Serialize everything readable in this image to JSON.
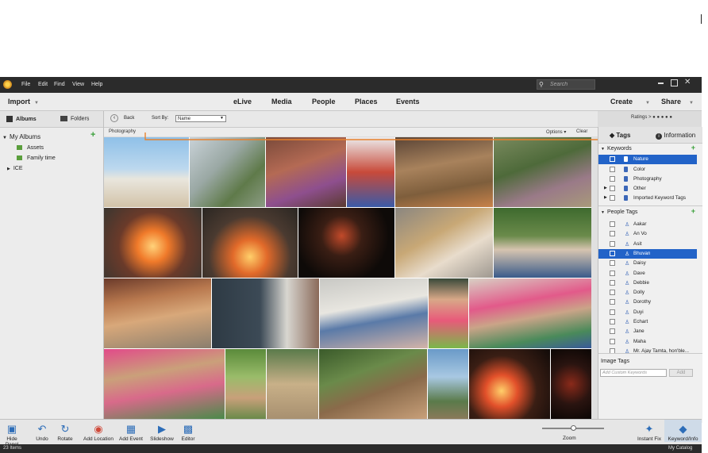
{
  "menubar": {
    "items": [
      "File",
      "Edit",
      "Find",
      "View",
      "Help"
    ],
    "search_placeholder": "Search"
  },
  "nav": {
    "import": "Import",
    "tabs": [
      "eLive",
      "Media",
      "People",
      "Places",
      "Events"
    ],
    "create": "Create",
    "share": "Share"
  },
  "left_panel": {
    "tab_albums": "Albums",
    "tab_folders": "Folders",
    "my_albums": "My Albums",
    "albums": [
      "Assets",
      "Family time"
    ],
    "ice": "ICE"
  },
  "toolbar": {
    "back": "Back",
    "sort_by": "Sort By:",
    "sort_value": "Name",
    "ratings": "Ratings",
    "folder": "Photography",
    "options": "Options",
    "clear": "Clear"
  },
  "right_panel": {
    "tab_tags": "Tags",
    "tab_information": "Information",
    "keywords_header": "Keywords",
    "keywords": [
      {
        "label": "Nature",
        "selected": true
      },
      {
        "label": "Color",
        "selected": false
      },
      {
        "label": "Photography",
        "selected": false
      },
      {
        "label": "Other",
        "selected": false
      },
      {
        "label": "Imported Keyword Tags",
        "selected": false
      }
    ],
    "people_header": "People Tags",
    "people": [
      {
        "label": "Aakar",
        "selected": false
      },
      {
        "label": "An Vo",
        "selected": false
      },
      {
        "label": "Asit",
        "selected": false
      },
      {
        "label": "Bhuvan",
        "selected": true
      },
      {
        "label": "Daisy",
        "selected": false
      },
      {
        "label": "Dave",
        "selected": false
      },
      {
        "label": "Debbie",
        "selected": false
      },
      {
        "label": "Dolly",
        "selected": false
      },
      {
        "label": "Dorothy",
        "selected": false
      },
      {
        "label": "Duyi",
        "selected": false
      },
      {
        "label": "Echart",
        "selected": false
      },
      {
        "label": "Jane",
        "selected": false
      },
      {
        "label": "Maha",
        "selected": false
      },
      {
        "label": "Mr. Ajay Tamta, hon'ble...",
        "selected": false
      }
    ],
    "image_tags": "Image Tags",
    "custom_placeholder": "Add Custom Keywords",
    "add": "Add"
  },
  "bottom": {
    "hide_panel": "Hide Panel",
    "undo": "Undo",
    "rotate": "Rotate",
    "add_location": "Add Location",
    "add_event": "Add Event",
    "slideshow": "Slideshow",
    "editor": "Editor",
    "zoom": "Zoom",
    "instant_fix": "Instant Fix",
    "keyword_info": "Keyword/Info",
    "zoom_level": 0.5
  },
  "status": {
    "items": "23 Items",
    "catalog": "My Catalog"
  },
  "colors": {
    "selection": "#2263c8",
    "annotation": "#e8822e",
    "plus": "#3aa03a"
  }
}
